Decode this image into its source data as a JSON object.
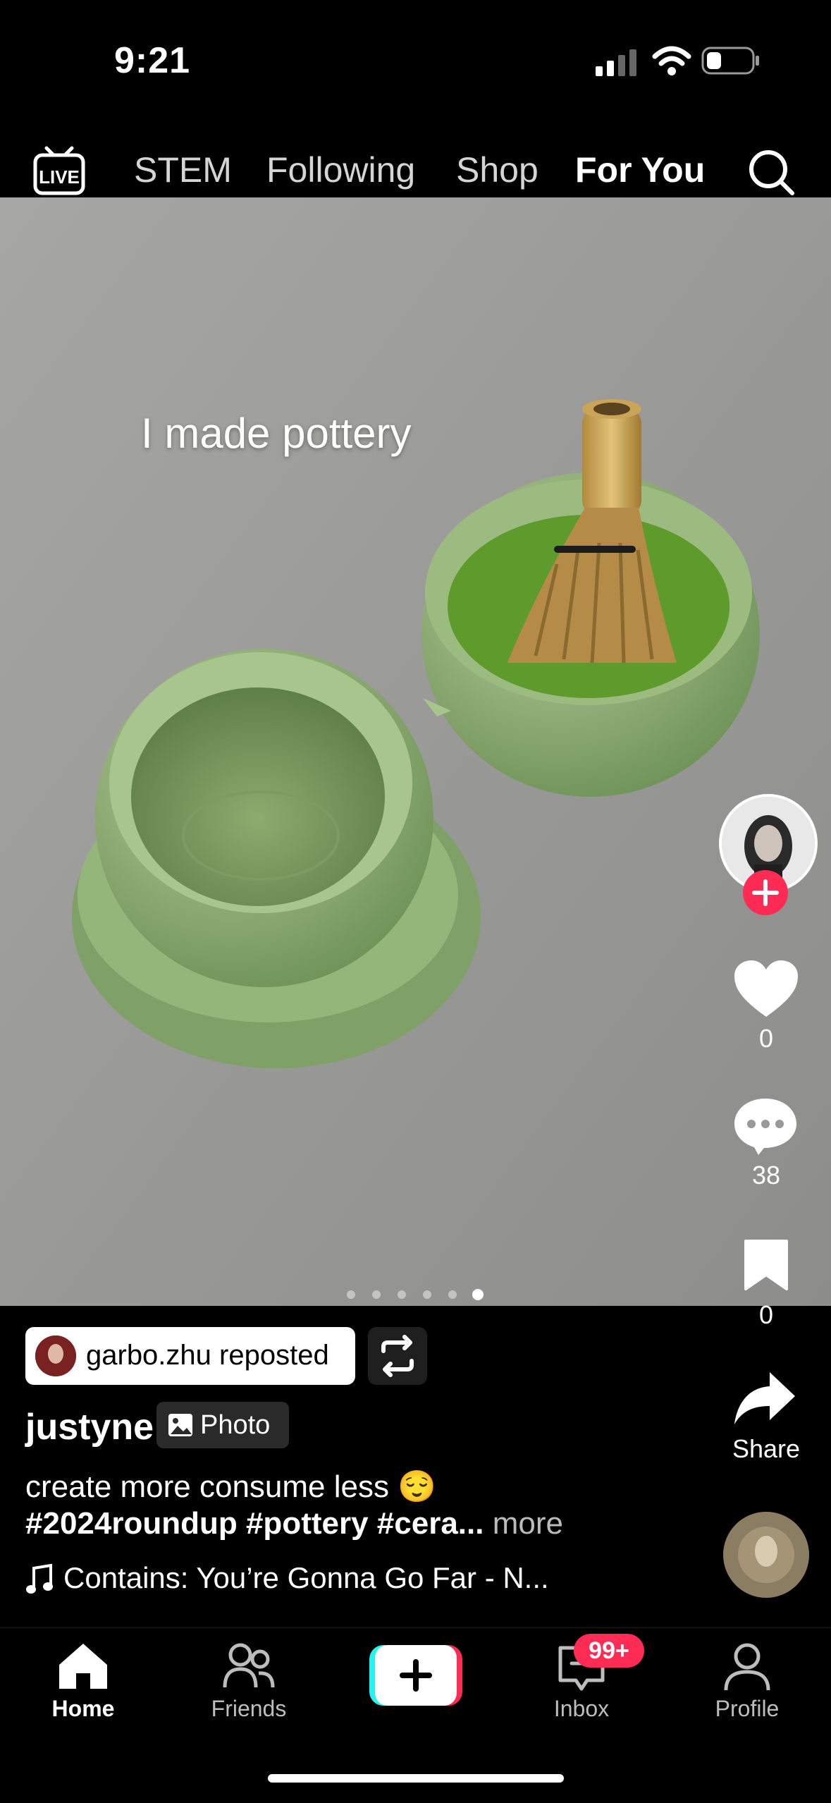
{
  "status_bar": {
    "time": "9:21",
    "battery_icon": "battery-icon",
    "wifi_icon": "wifi-icon",
    "signal_icon": "signal-icon"
  },
  "top_nav": {
    "live_label": "LIVE",
    "tabs": [
      {
        "label": "STEM"
      },
      {
        "label": "Following"
      },
      {
        "label": "Shop"
      },
      {
        "label": "For You"
      }
    ],
    "active_tab": "For You"
  },
  "post": {
    "overlay_text": "I made pottery",
    "carousel": {
      "count": 6,
      "active_index": 6
    },
    "repost": {
      "text": "garbo.zhu reposted"
    },
    "username": "justyne",
    "type_chip": "Photo",
    "description": "create more consume less 😌",
    "hashtags": "#2024roundup #pottery #cera...",
    "more_label": "more",
    "music": "Contains: You’re Gonna Go Far - N..."
  },
  "actions": {
    "likes": "0",
    "comments": "38",
    "saves": "0",
    "share_label": "Share"
  },
  "bottom_nav": {
    "items": [
      {
        "label": "Home"
      },
      {
        "label": "Friends"
      },
      {
        "label": "Inbox"
      },
      {
        "label": "Profile"
      }
    ],
    "inbox_badge": "99+"
  },
  "colors": {
    "accent": "#fe2c55",
    "ceramic": "#8fae73",
    "tiktok_cyan": "#25f4ee"
  }
}
